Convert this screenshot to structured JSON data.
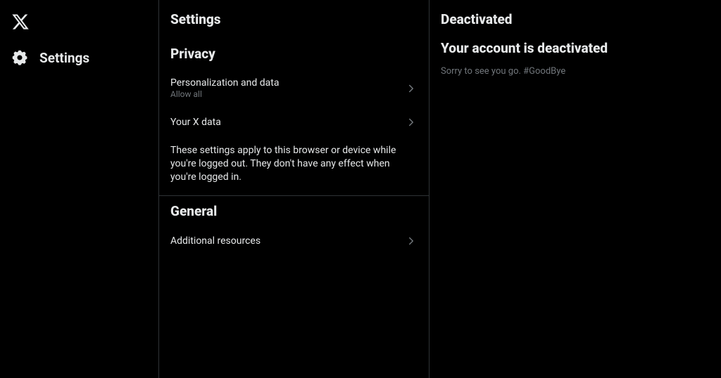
{
  "sidebar": {
    "nav_label": "Settings"
  },
  "middle": {
    "title": "Settings",
    "privacy_section": "Privacy",
    "items": [
      {
        "primary": "Personalization and data",
        "secondary": "Allow all"
      },
      {
        "primary": "Your X data",
        "secondary": ""
      }
    ],
    "privacy_desc": "These settings apply to this browser or device while you're logged out. They don't have any effect when you're logged in.",
    "general_section": "General",
    "general_items": [
      {
        "primary": "Additional resources",
        "secondary": ""
      }
    ]
  },
  "right": {
    "title": "Deactivated",
    "heading": "Your account is deactivated",
    "body": "Sorry to see you go. #GoodBye"
  }
}
